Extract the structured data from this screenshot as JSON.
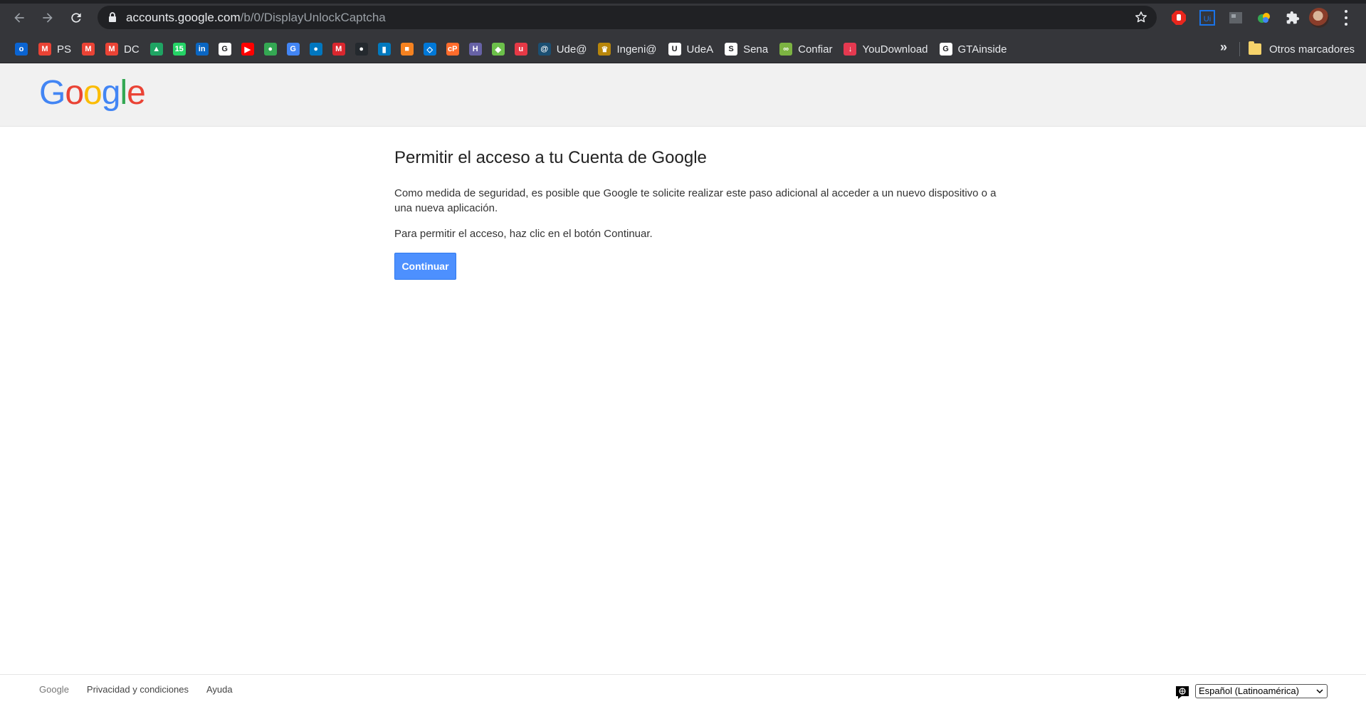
{
  "browser": {
    "url_host": "accounts.google.com",
    "url_path": "/b/0/DisplayUnlockCaptcha",
    "bookmarks": [
      {
        "label": "",
        "icon": "outlook-icon",
        "color": "#0a64d2",
        "glyph": "o"
      },
      {
        "label": "PS",
        "icon": "gmail-icon",
        "color": "#ea4335",
        "glyph": "M"
      },
      {
        "label": "",
        "icon": "gmail-icon",
        "color": "#ea4335",
        "glyph": "M"
      },
      {
        "label": "DC",
        "icon": "gmail-icon",
        "color": "#ea4335",
        "glyph": "M"
      },
      {
        "label": "",
        "icon": "google-drive-icon",
        "color": "#1fa463",
        "glyph": "▲"
      },
      {
        "label": "",
        "icon": "whatsapp-icon",
        "color": "#25d366",
        "glyph": "15"
      },
      {
        "label": "",
        "icon": "linkedin-icon",
        "color": "#0a66c2",
        "glyph": "in"
      },
      {
        "label": "",
        "icon": "google-icon",
        "color": "#ffffff",
        "glyph": "G"
      },
      {
        "label": "",
        "icon": "youtube-icon",
        "color": "#ff0000",
        "glyph": "▶"
      },
      {
        "label": "",
        "icon": "google-maps-icon",
        "color": "#34a853",
        "glyph": "●"
      },
      {
        "label": "",
        "icon": "google-translate-icon",
        "color": "#4285f4",
        "glyph": "G"
      },
      {
        "label": "",
        "icon": "drupal-icon",
        "color": "#0077c0",
        "glyph": "●"
      },
      {
        "label": "",
        "icon": "mega-icon",
        "color": "#d9272e",
        "glyph": "M"
      },
      {
        "label": "",
        "icon": "github-icon",
        "color": "#24292e",
        "glyph": "●"
      },
      {
        "label": "",
        "icon": "trello-icon",
        "color": "#0079bf",
        "glyph": "▮"
      },
      {
        "label": "",
        "icon": "box-icon",
        "color": "#f58220",
        "glyph": "■"
      },
      {
        "label": "",
        "icon": "azure-devops-icon",
        "color": "#0078d7",
        "glyph": "◇"
      },
      {
        "label": "",
        "icon": "cpanel-icon",
        "color": "#ff6c2c",
        "glyph": "cP"
      },
      {
        "label": "",
        "icon": "heroku-icon",
        "color": "#6762a6",
        "glyph": "H"
      },
      {
        "label": "",
        "icon": "feedly-icon",
        "color": "#6cc04a",
        "glyph": "◆"
      },
      {
        "label": "",
        "icon": "udemy-icon",
        "color": "#e63946",
        "glyph": "u"
      },
      {
        "label": "Ude@",
        "icon": "udea-virtual-icon",
        "color": "#1b4f72",
        "glyph": "@"
      },
      {
        "label": "Ingeni@",
        "icon": "ingenia-icon",
        "color": "#b8860b",
        "glyph": "♛"
      },
      {
        "label": "UdeA",
        "icon": "udea-icon",
        "color": "#ffffff",
        "glyph": "U"
      },
      {
        "label": "Sena",
        "icon": "sena-icon",
        "color": "#ffffff",
        "glyph": "S"
      },
      {
        "label": "Confiar",
        "icon": "confiar-icon",
        "color": "#7cb342",
        "glyph": "∞"
      },
      {
        "label": "YouDownload",
        "icon": "youdownload-icon",
        "color": "#e53950",
        "glyph": "↓"
      },
      {
        "label": "GTAinside",
        "icon": "gtainside-icon",
        "color": "#ffffff",
        "glyph": "G"
      }
    ],
    "more_label": "»",
    "other_bookmarks": "Otros marcadores"
  },
  "page": {
    "logo": [
      "G",
      "o",
      "o",
      "g",
      "l",
      "e"
    ],
    "logo_colors": [
      "#4285f4",
      "#ea4335",
      "#fbbc05",
      "#4285f4",
      "#34a853",
      "#ea4335"
    ],
    "title": "Permitir el acceso a tu Cuenta de Google",
    "paragraph1": "Como medida de seguridad, es posible que Google te solicite realizar este paso adicional al acceder a un nuevo dispositivo o a una nueva aplicación.",
    "paragraph2": "Para permitir el acceso, haz clic en el botón Continuar.",
    "button": "Continuar"
  },
  "footer": {
    "brand": "Google",
    "privacy": "Privacidad y condiciones",
    "help": "Ayuda",
    "language": "Español (Latinoamérica)"
  }
}
